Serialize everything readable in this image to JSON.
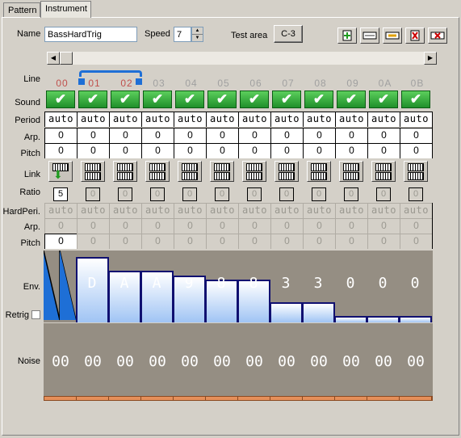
{
  "tabs": [
    {
      "label": "Pattern"
    },
    {
      "label": "Instrument"
    }
  ],
  "header": {
    "name_label": "Name",
    "name_value": "BassHardTrig",
    "speed_label": "Speed",
    "speed_value": "7",
    "test_area_label": "Test area",
    "test_note": "C-3"
  },
  "toolbar_icons": [
    "insert-column-icon",
    "duplicate-column-icon",
    "copy-column-icon",
    "delete-column-icon",
    "clear-column-icon"
  ],
  "row_labels": {
    "line": "Line",
    "sound": "Sound",
    "period": "Period",
    "arp": "Arp.",
    "pitch": "Pitch",
    "link": "Link",
    "ratio": "Ratio",
    "hard_period": "HardPeri.",
    "hard_arp": "Arp.",
    "hard_pitch": "Pitch",
    "env": "Env.",
    "retrig": "Retrig",
    "noise": "Noise"
  },
  "lines": [
    "00",
    "01",
    "02",
    "03",
    "04",
    "05",
    "06",
    "07",
    "08",
    "09",
    "0A",
    "0B"
  ],
  "sound_check": "✔",
  "period": [
    "auto",
    "auto",
    "auto",
    "auto",
    "auto",
    "auto",
    "auto",
    "auto",
    "auto",
    "auto",
    "auto",
    "auto"
  ],
  "arp": [
    "0",
    "0",
    "0",
    "0",
    "0",
    "0",
    "0",
    "0",
    "0",
    "0",
    "0",
    "0"
  ],
  "pitch": [
    "0",
    "0",
    "0",
    "0",
    "0",
    "0",
    "0",
    "0",
    "0",
    "0",
    "0",
    "0"
  ],
  "ratio": [
    "5",
    "0",
    "0",
    "0",
    "0",
    "0",
    "0",
    "0",
    "0",
    "0",
    "0",
    "0"
  ],
  "hard_period": [
    "auto",
    "auto",
    "auto",
    "auto",
    "auto",
    "auto",
    "auto",
    "auto",
    "auto",
    "auto",
    "auto",
    "auto"
  ],
  "hard_arp": [
    "0",
    "0",
    "0",
    "0",
    "0",
    "0",
    "0",
    "0",
    "0",
    "0",
    "0",
    "0"
  ],
  "hard_pitch": [
    "0",
    "0",
    "0",
    "0",
    "0",
    "0",
    "0",
    "0",
    "0",
    "0",
    "0",
    "0"
  ],
  "env_labels": [
    "",
    "",
    "D",
    "A",
    "A",
    "9",
    "8",
    "8",
    "3",
    "3",
    "0",
    "0",
    "0"
  ],
  "noise": [
    "00",
    "00",
    "00",
    "00",
    "00",
    "00",
    "00",
    "00",
    "00",
    "00",
    "00",
    "00"
  ],
  "colors": {
    "selected_line": "#c0504d",
    "env_background": "#958e83",
    "sound_green": "#2ea33a"
  }
}
